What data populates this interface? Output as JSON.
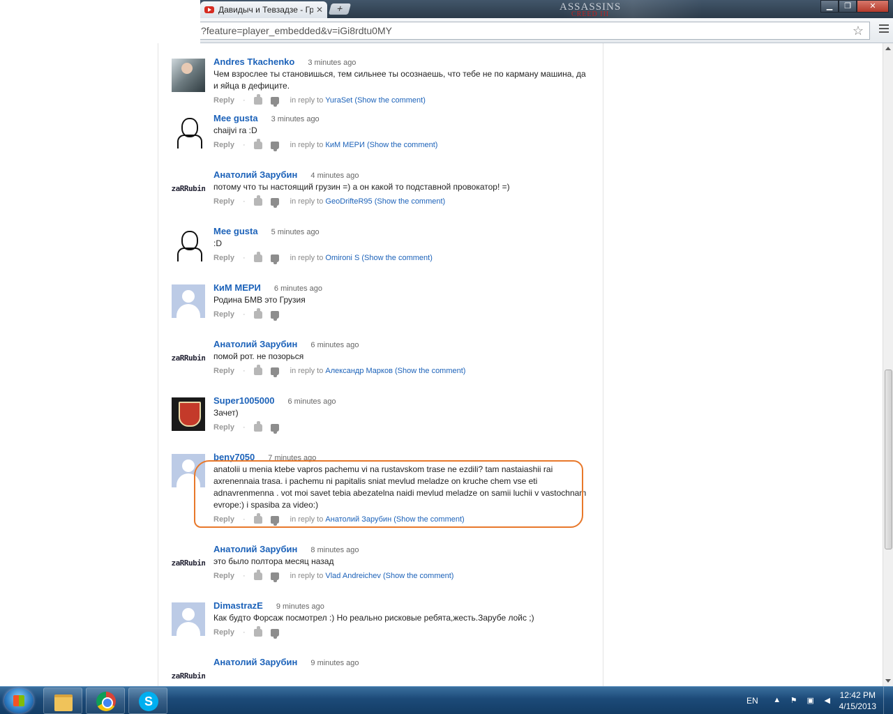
{
  "browser": {
    "tab_title": "Давидыч и Тевзадзе - Гру",
    "tab_close": "✕",
    "new_tab": "+",
    "brand": "ASSASSINS",
    "brand_sub": "CREED III",
    "url": "?feature=player_embedded&v=iGi8rdtu0MY",
    "window_buttons": {
      "minimize": "▁",
      "maximize": "❐",
      "close": "✕"
    }
  },
  "comments": [
    {
      "author": "Andres Tkachenko",
      "time": "3 minutes ago",
      "avatar": "photo",
      "text": "Чем взрослее ты становишься, тем сильнее ты осознаешь, что тебе не по карману машина, да и яйца в дефиците.",
      "reply": "Reply",
      "in_reply_prefix": "in reply to",
      "in_reply_to": "YuraSet",
      "show": "(Show the comment)"
    },
    {
      "author": "Mee gusta",
      "time": "3 minutes ago",
      "avatar": "meme",
      "text": "chaijvi ra :D",
      "reply": "Reply",
      "in_reply_prefix": "in reply to",
      "in_reply_to": "КиМ МЕРИ",
      "show": "(Show the comment)"
    },
    {
      "author": "Анатолий Зарубин",
      "time": "4 minutes ago",
      "avatar": "zarrubin",
      "text": "потому что ты настоящий грузин =) а он какой то подставной провокатор! =)",
      "reply": "Reply",
      "in_reply_prefix": "in reply to",
      "in_reply_to": "GeoDrifteR95",
      "show": "(Show the comment)"
    },
    {
      "author": "Mee gusta",
      "time": "5 minutes ago",
      "avatar": "meme",
      "text": ":D",
      "reply": "Reply",
      "in_reply_prefix": "in reply to",
      "in_reply_to": "Omironi S",
      "show": "(Show the comment)"
    },
    {
      "author": "КиМ МЕРИ",
      "time": "6 minutes ago",
      "avatar": "default",
      "text": "Родина БМВ это Грузия",
      "reply": "Reply",
      "in_reply_prefix": "",
      "in_reply_to": "",
      "show": ""
    },
    {
      "author": "Анатолий Зарубин",
      "time": "6 minutes ago",
      "avatar": "zarrubin",
      "text": "помой рот. не позорься",
      "reply": "Reply",
      "in_reply_prefix": "in reply to",
      "in_reply_to": "Александр Марков",
      "show": "(Show the comment)"
    },
    {
      "author": "Super1005000",
      "time": "6 minutes ago",
      "avatar": "emblem",
      "text": "Зачет)",
      "reply": "Reply",
      "in_reply_prefix": "",
      "in_reply_to": "",
      "show": ""
    },
    {
      "author": "beny7050",
      "time": "7 minutes ago",
      "avatar": "default",
      "text": "anatolii u menia ktebe vapros pachemu vi na rustavskom trase ne ezdili? tam nastaiashii rai axrenennaia trasa. i pachemu ni papitalis sniat mevlud meladze on kruche chem vse eti adnavrenmenna . vot moi savet tebia abezatelna naidi mevlud meladze on samii luchii v vastochnam evrope:) i spasiba za video:)",
      "reply": "Reply",
      "in_reply_prefix": "in reply to",
      "in_reply_to": "Анатолий Зарубин",
      "show": "(Show the comment)"
    },
    {
      "author": "Анатолий Зарубин",
      "time": "8 minutes ago",
      "avatar": "zarrubin",
      "text": "это было полтора месяц назад",
      "reply": "Reply",
      "in_reply_prefix": "in reply to",
      "in_reply_to": "Vlad Andreichev",
      "show": "(Show the comment)"
    },
    {
      "author": "DimastrazE",
      "time": "9 minutes ago",
      "avatar": "default",
      "text": "Как будто Форсаж посмотрел :) Но реально рисковые ребята,жесть.Зарубе лойс ;)",
      "reply": "Reply",
      "in_reply_prefix": "",
      "in_reply_to": "",
      "show": ""
    },
    {
      "author": "Анатолий Зарубин",
      "time": "9 minutes ago",
      "avatar": "zarrubin",
      "text": "",
      "reply": "",
      "in_reply_prefix": "",
      "in_reply_to": "",
      "show": ""
    }
  ],
  "avatar_text": {
    "zarrubin": "zaRRubin"
  },
  "colors": {
    "link": "#1c62b9",
    "highlight": "#e8782a"
  },
  "taskbar": {
    "language": "EN",
    "time": "12:42 PM",
    "date": "4/15/2013"
  }
}
